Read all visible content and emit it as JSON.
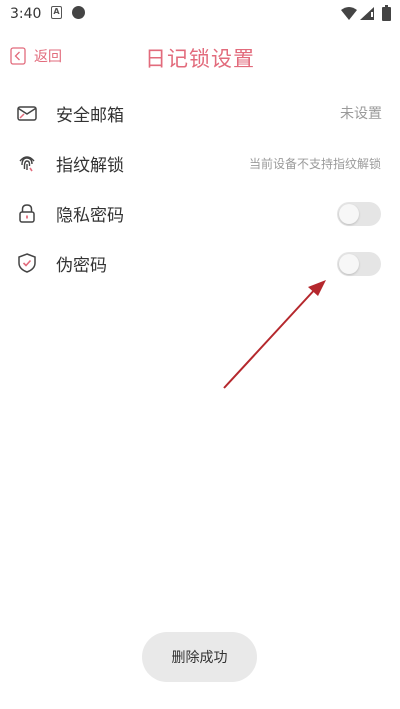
{
  "status_bar": {
    "time": "3:40",
    "indicator_letter": "A",
    "icons": [
      "notification-a-icon",
      "app-notification-icon",
      "wifi-icon",
      "signal-icon",
      "battery-icon"
    ]
  },
  "header": {
    "back_label": "返回",
    "title": "日记锁设置",
    "accent_color": "#e26b7c"
  },
  "settings": [
    {
      "icon": "mail-icon",
      "label": "安全邮箱",
      "value": "未设置",
      "control": "value"
    },
    {
      "icon": "fingerprint-icon",
      "label": "指纹解锁",
      "value": "当前设备不支持指纹解锁",
      "control": "value"
    },
    {
      "icon": "lock-icon",
      "label": "隐私密码",
      "control": "toggle",
      "toggle_on": false
    },
    {
      "icon": "shield-icon",
      "label": "伪密码",
      "control": "toggle",
      "toggle_on": false
    }
  ],
  "annotation": {
    "type": "arrow",
    "color": "#b5282d"
  },
  "toast": {
    "message": "删除成功"
  }
}
